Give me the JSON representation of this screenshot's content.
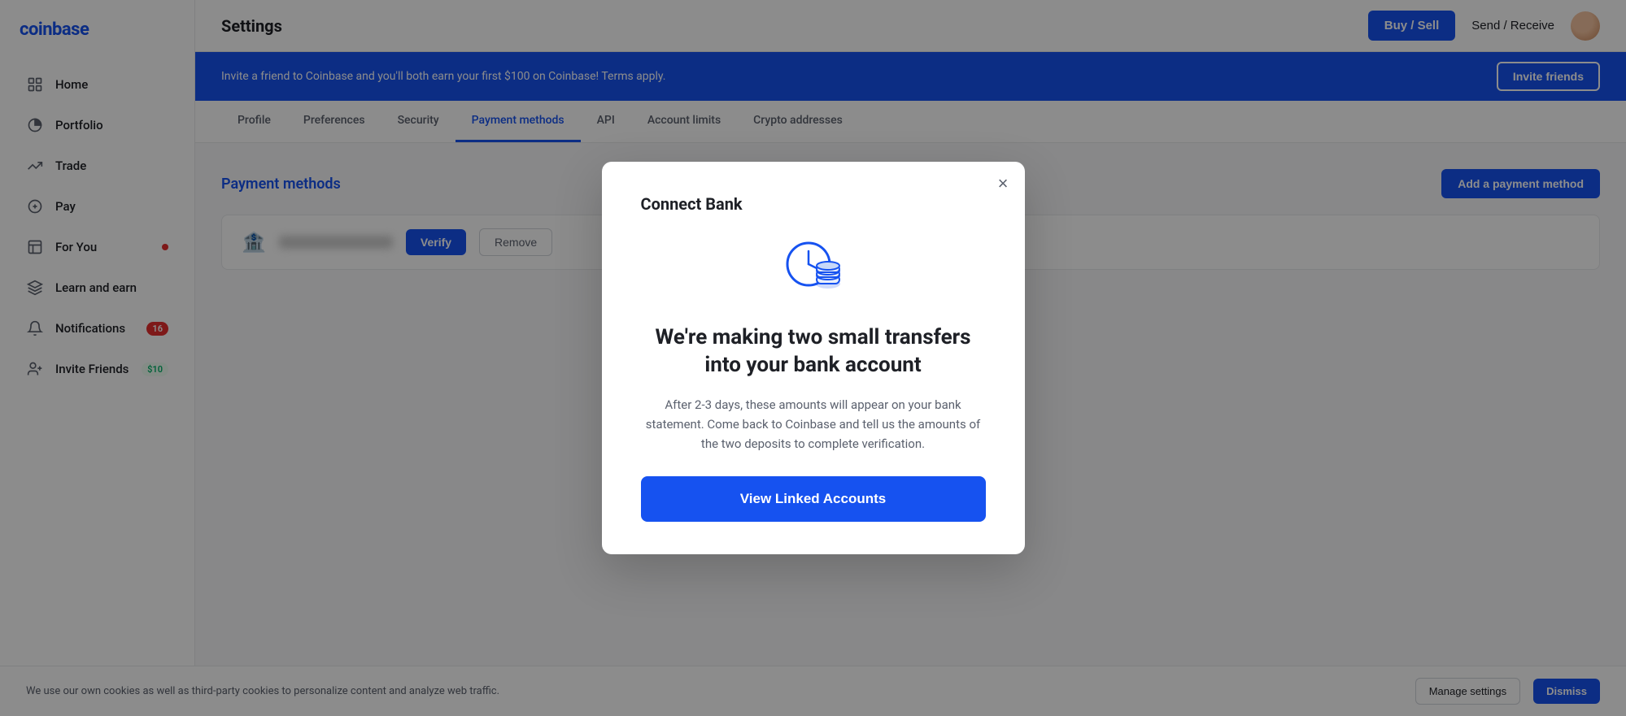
{
  "sidebar": {
    "logo": "coinbase",
    "items": [
      {
        "id": "home",
        "label": "Home",
        "icon": "home",
        "badge": null
      },
      {
        "id": "portfolio",
        "label": "Portfolio",
        "icon": "portfolio",
        "badge": null
      },
      {
        "id": "trade",
        "label": "Trade",
        "icon": "trade",
        "badge": null
      },
      {
        "id": "pay",
        "label": "Pay",
        "icon": "pay",
        "badge": null
      },
      {
        "id": "foryou",
        "label": "For You",
        "icon": "foryou",
        "badge": "dot"
      },
      {
        "id": "learnandearn",
        "label": "Learn and earn",
        "icon": "learn",
        "badge": null
      },
      {
        "id": "notifications",
        "label": "Notifications",
        "icon": "notifications",
        "badge": "16"
      },
      {
        "id": "invitefriends",
        "label": "Invite Friends",
        "icon": "invite",
        "badge": "$10"
      }
    ]
  },
  "topbar": {
    "title": "Settings",
    "buy_sell_label": "Buy / Sell",
    "send_receive_label": "Send / Receive"
  },
  "banner": {
    "text": "Invite a friend to Coinbase and you'll both earn your first $100 on Coinbase! Terms apply.",
    "button_label": "Invite friends"
  },
  "tabs": [
    {
      "id": "profile",
      "label": "Profile"
    },
    {
      "id": "preferences",
      "label": "Preferences"
    },
    {
      "id": "security",
      "label": "Security"
    },
    {
      "id": "payment-methods",
      "label": "Payment methods",
      "active": true
    },
    {
      "id": "api",
      "label": "API"
    },
    {
      "id": "account-limits",
      "label": "Account limits"
    },
    {
      "id": "crypto-addresses",
      "label": "Crypto addresses"
    }
  ],
  "payment_methods": {
    "section_title": "Payment methods",
    "add_button": "Add a payment method",
    "bank_icon": "🏦",
    "verify_label": "Verify",
    "remove_label": "Remove"
  },
  "modal": {
    "title": "Connect Bank",
    "close_label": "×",
    "heading": "We're making two small transfers into your bank account",
    "body": "After 2-3 days, these amounts will appear on your bank statement. Come back to Coinbase and tell us the amounts of the two deposits to complete verification.",
    "cta_label": "View Linked Accounts"
  },
  "cookie_bar": {
    "text": "We use our own cookies as well as third-party cookies to personalize content and analyze web traffic.",
    "manage_label": "Manage settings",
    "dismiss_label": "Dismiss"
  },
  "colors": {
    "primary": "#1652f0",
    "danger": "#e52e2e"
  }
}
